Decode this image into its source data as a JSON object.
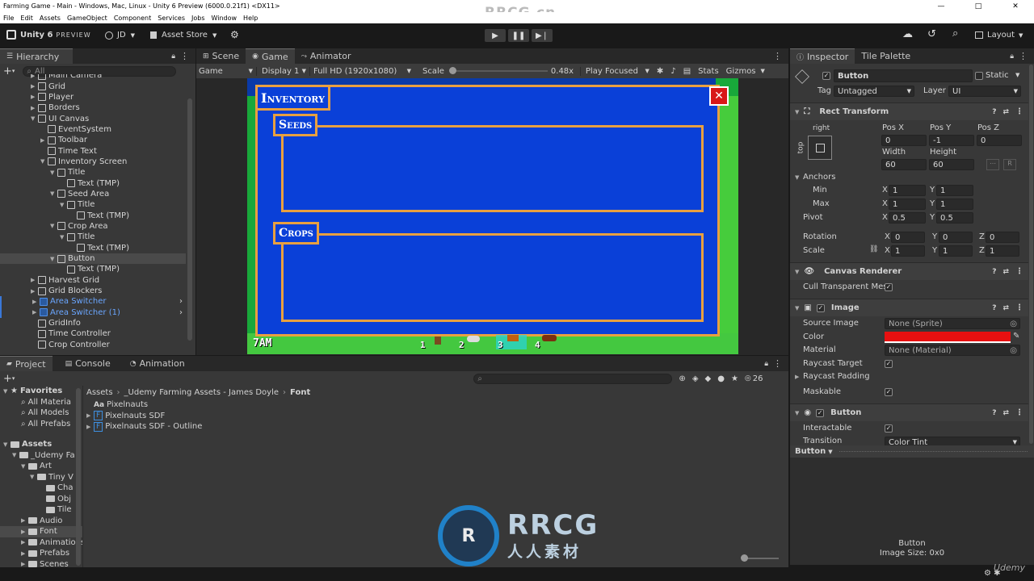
{
  "window": {
    "title": "Farming Game - Main - Windows, Mac, Linux - Unity 6 Preview (6000.0.21f1) <DX11>",
    "minimize": "—",
    "maximize": "□",
    "close": "✕"
  },
  "watermark": "RRCG.cn",
  "menu": [
    "File",
    "Edit",
    "Assets",
    "GameObject",
    "Component",
    "Services",
    "Jobs",
    "Window",
    "Help"
  ],
  "toolbar": {
    "logo": "Unity 6",
    "badge": "PREVIEW",
    "account": "JD",
    "asset_store": "Asset Store",
    "layout": "Layout"
  },
  "hierarchy": {
    "tab": "Hierarchy",
    "search_placeholder": "All",
    "items": [
      {
        "label": "Main Camera",
        "indent": 0,
        "arrow": "▶",
        "blue": false
      },
      {
        "label": "Grid",
        "indent": 0,
        "arrow": "▶",
        "blue": false
      },
      {
        "label": "Player",
        "indent": 0,
        "arrow": "▶",
        "blue": false
      },
      {
        "label": "Borders",
        "indent": 0,
        "arrow": "▶",
        "blue": false
      },
      {
        "label": "UI Canvas",
        "indent": 0,
        "arrow": "▼",
        "blue": false
      },
      {
        "label": "EventSystem",
        "indent": 1,
        "arrow": "",
        "blue": false
      },
      {
        "label": "Toolbar",
        "indent": 1,
        "arrow": "▶",
        "blue": false
      },
      {
        "label": "Time Text",
        "indent": 1,
        "arrow": "",
        "blue": false
      },
      {
        "label": "Inventory Screen",
        "indent": 1,
        "arrow": "▼",
        "blue": false
      },
      {
        "label": "Title",
        "indent": 2,
        "arrow": "▼",
        "blue": false
      },
      {
        "label": "Text (TMP)",
        "indent": 3,
        "arrow": "",
        "blue": false
      },
      {
        "label": "Seed Area",
        "indent": 2,
        "arrow": "▼",
        "blue": false
      },
      {
        "label": "Title",
        "indent": 3,
        "arrow": "▼",
        "blue": false
      },
      {
        "label": "Text (TMP)",
        "indent": 4,
        "arrow": "",
        "blue": false
      },
      {
        "label": "Crop Area",
        "indent": 2,
        "arrow": "▼",
        "blue": false
      },
      {
        "label": "Title",
        "indent": 3,
        "arrow": "▼",
        "blue": false
      },
      {
        "label": "Text (TMP)",
        "indent": 4,
        "arrow": "",
        "blue": false
      },
      {
        "label": "Button",
        "indent": 2,
        "arrow": "▼",
        "blue": false,
        "selected": true
      },
      {
        "label": "Text (TMP)",
        "indent": 3,
        "arrow": "",
        "blue": false
      },
      {
        "label": "Harvest Grid",
        "indent": 0,
        "arrow": "▶",
        "blue": false
      },
      {
        "label": "Grid Blockers",
        "indent": 0,
        "arrow": "▶",
        "blue": false
      },
      {
        "label": "Area Switcher",
        "indent": 0,
        "arrow": "▶",
        "blue": true
      },
      {
        "label": "Area Switcher (1)",
        "indent": 0,
        "arrow": "▶",
        "blue": true
      },
      {
        "label": "GridInfo",
        "indent": 0,
        "arrow": "",
        "blue": false
      },
      {
        "label": "Time Controller",
        "indent": 0,
        "arrow": "",
        "blue": false
      },
      {
        "label": "Crop Controller",
        "indent": 0,
        "arrow": "",
        "blue": false
      }
    ]
  },
  "scene_tabs": {
    "scene": "Scene",
    "game": "Game",
    "animator": "Animator"
  },
  "game_bar": {
    "mode": "Game",
    "display": "Display 1",
    "resolution": "Full HD (1920x1080)",
    "scale_label": "Scale",
    "scale_value": "0.48x",
    "play_focused": "Play Focused",
    "stats": "Stats",
    "gizmos": "Gizmos"
  },
  "game": {
    "inventory": "Inventory",
    "seeds": "Seeds",
    "crops": "Crops",
    "close": "✕",
    "time": "7AM",
    "slots": [
      "1",
      "2",
      "3",
      "4"
    ]
  },
  "project": {
    "tabs": [
      "Project",
      "Console",
      "Animation"
    ],
    "hidden_count": "26",
    "favorites": "Favorites",
    "fav_items": [
      "All Materia",
      "All Models",
      "All Prefabs"
    ],
    "assets": "Assets",
    "tree": [
      {
        "label": "_Udemy Fa",
        "indent": 1
      },
      {
        "label": "Art",
        "indent": 2
      },
      {
        "label": "Tiny V",
        "indent": 3
      },
      {
        "label": "Cha",
        "indent": 4
      },
      {
        "label": "Obj",
        "indent": 4
      },
      {
        "label": "Tile",
        "indent": 4
      },
      {
        "label": "Audio",
        "indent": 2
      },
      {
        "label": "Font",
        "indent": 2,
        "selected": true
      },
      {
        "label": "Animations",
        "indent": 2
      },
      {
        "label": "Prefabs",
        "indent": 2
      },
      {
        "label": "Scenes",
        "indent": 2
      }
    ],
    "breadcrumb": [
      "Assets",
      "_Udemy Farming Assets - James Doyle",
      "Font"
    ],
    "files": [
      {
        "icon": "Aa",
        "label": "Pixelnauts"
      },
      {
        "icon": "F",
        "label": "Pixelnauts SDF"
      },
      {
        "icon": "F",
        "label": "Pixelnauts SDF - Outline"
      }
    ]
  },
  "inspector": {
    "tabs": [
      "Inspector",
      "Tile Palette"
    ],
    "name": "Button",
    "static": "Static",
    "tag_label": "Tag",
    "tag": "Untagged",
    "layer_label": "Layer",
    "layer": "UI",
    "rect": {
      "title": "Rect Transform",
      "anchor_h": "right",
      "anchor_v": "top",
      "posx_l": "Pos X",
      "posy_l": "Pos Y",
      "posz_l": "Pos Z",
      "posx": "0",
      "posy": "-1",
      "posz": "0",
      "w_l": "Width",
      "h_l": "Height",
      "w": "60",
      "h": "60",
      "r": "R",
      "anchors": "Anchors",
      "min": "Min",
      "max": "Max",
      "min_x": "1",
      "min_y": "1",
      "max_x": "1",
      "max_y": "1",
      "pivot": "Pivot",
      "pivot_x": "0.5",
      "pivot_y": "0.5",
      "rotation": "Rotation",
      "rot_x": "0",
      "rot_y": "0",
      "rot_z": "0",
      "scale": "Scale",
      "sc_x": "1",
      "sc_y": "1",
      "sc_z": "1",
      "x": "X",
      "y": "Y",
      "z": "Z"
    },
    "canvas_renderer": {
      "title": "Canvas Renderer",
      "cull": "Cull Transparent Mes"
    },
    "image": {
      "title": "Image",
      "source_l": "Source Image",
      "source": "None (Sprite)",
      "color_l": "Color",
      "color": "#e81010",
      "material_l": "Material",
      "material": "None (Material)",
      "raycast_target": "Raycast Target",
      "raycast_padding": "Raycast Padding",
      "maskable": "Maskable"
    },
    "button": {
      "title": "Button",
      "interactable": "Interactable",
      "transition_l": "Transition",
      "transition": "Color Tint"
    },
    "preview": {
      "title": "Button",
      "name": "Button",
      "size": "Image Size: 0x0"
    }
  },
  "logo": {
    "big": "RRCG",
    "sub": "人人素材"
  },
  "udemy": "Udemy"
}
